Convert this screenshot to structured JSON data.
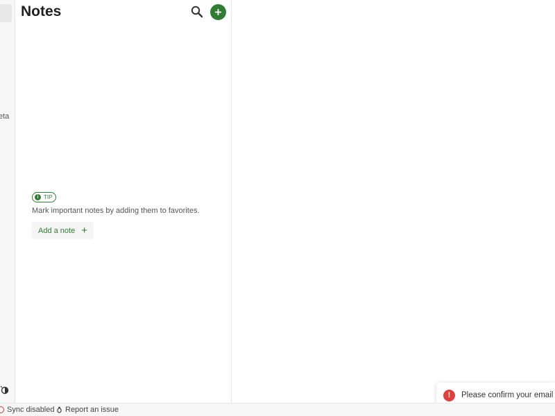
{
  "nav": {
    "partial_label": "eta"
  },
  "notes_panel": {
    "title": "Notes",
    "search_icon": "search-icon",
    "add_icon": "plus-icon"
  },
  "empty_state": {
    "badge": "TIP",
    "tip_text": "Mark important notes by adding them to favorites.",
    "add_note_label": "Add a note"
  },
  "toast": {
    "message": "Please confirm your email t",
    "icon": "error-icon",
    "color": "#e0403a"
  },
  "statusbar": {
    "sync_label": "Sync disabled",
    "report_label": "Report an issue"
  },
  "colors": {
    "accent": "#2e7d32",
    "error": "#e0403a"
  }
}
